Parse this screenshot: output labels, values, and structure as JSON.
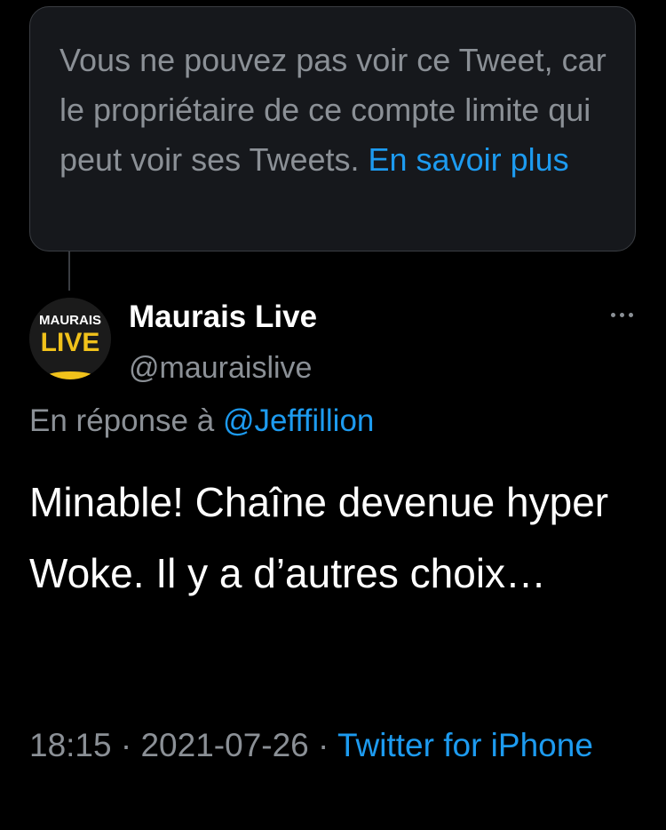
{
  "restricted_notice": {
    "text": "Vous ne pouvez pas voir ce Tweet, car le propriétaire de ce compte limite qui peut voir ses Tweets.",
    "link_label": "En savoir plus"
  },
  "tweet": {
    "avatar_text_top": "MAURAIS",
    "avatar_text_bottom": "LIVE",
    "display_name": "Maurais Live",
    "handle": "@mauraislive",
    "reply_prefix": "En réponse à",
    "reply_mention": "@Jefffillion",
    "text": "Minable! Chaîne devenue hyper Woke. Il y a d’autres choix…",
    "time": "18:15",
    "separator": "·",
    "date": "2021-07-26",
    "source": "Twitter for iPhone"
  },
  "colors": {
    "background": "#000000",
    "card": "#16181c",
    "accent": "#1d9bf0",
    "secondary_text": "#8b9096"
  },
  "icons": {
    "more": "more-horizontal-icon"
  }
}
